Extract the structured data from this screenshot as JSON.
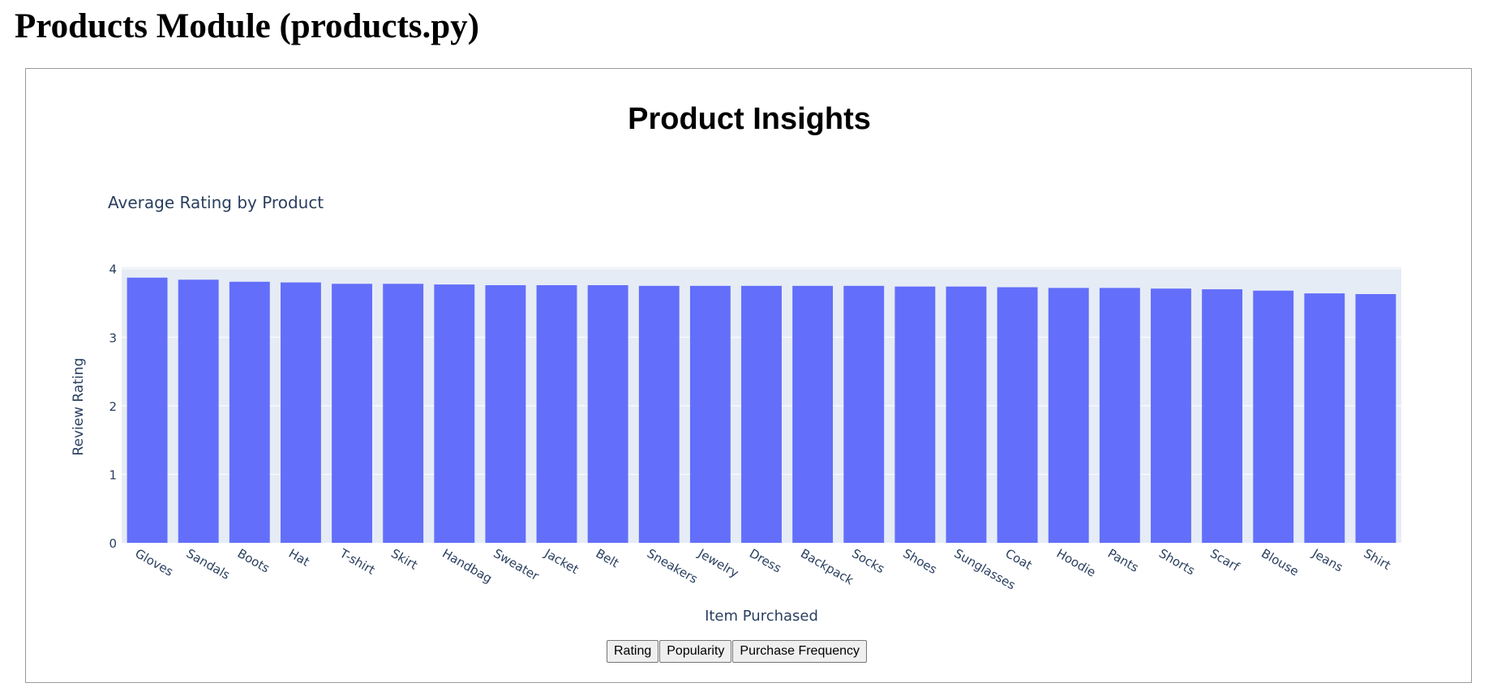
{
  "page": {
    "heading": "Products Module (products.py)"
  },
  "controls": {
    "buttons": [
      {
        "label": "Rating"
      },
      {
        "label": "Popularity"
      },
      {
        "label": "Purchase Frequency"
      }
    ]
  },
  "colors": {
    "bar": "#636efa",
    "plot_bg": "#e5ecf6",
    "grid": "#ffffff",
    "axis_text": "#2a3f5f"
  },
  "chart_data": {
    "type": "bar",
    "title": "Product Insights",
    "subtitle": "Average Rating by Product",
    "xlabel": "Item Purchased",
    "ylabel": "Review Rating",
    "ylim": [
      0,
      4.02
    ],
    "yticks": [
      0,
      1,
      2,
      3,
      4
    ],
    "grid": true,
    "categories": [
      "Gloves",
      "Sandals",
      "Boots",
      "Hat",
      "T-shirt",
      "Skirt",
      "Handbag",
      "Sweater",
      "Jacket",
      "Belt",
      "Sneakers",
      "Jewelry",
      "Dress",
      "Backpack",
      "Socks",
      "Shoes",
      "Sunglasses",
      "Coat",
      "Hoodie",
      "Pants",
      "Shorts",
      "Scarf",
      "Blouse",
      "Jeans",
      "Shirt"
    ],
    "values": [
      3.87,
      3.84,
      3.81,
      3.8,
      3.78,
      3.78,
      3.77,
      3.76,
      3.76,
      3.76,
      3.75,
      3.75,
      3.75,
      3.75,
      3.75,
      3.74,
      3.74,
      3.73,
      3.72,
      3.72,
      3.71,
      3.7,
      3.68,
      3.64,
      3.63
    ]
  }
}
